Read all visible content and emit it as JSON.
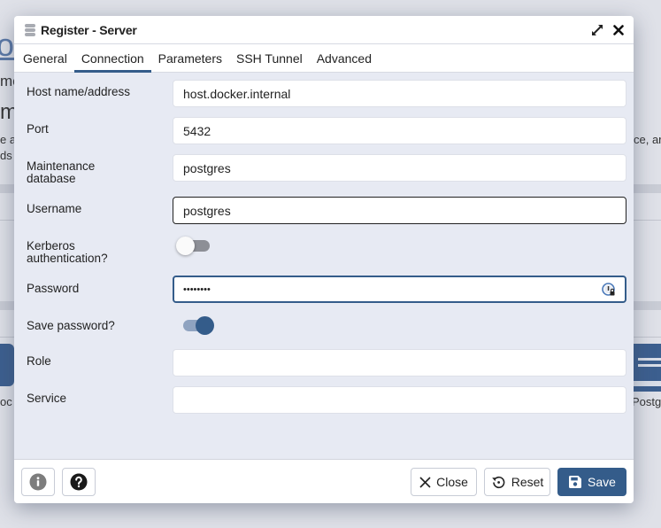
{
  "background": {
    "heading_fragment": "o",
    "line_fragments": [
      "me",
      "m",
      "e ac",
      "ds"
    ],
    "right_fragment": "ce, ar",
    "left_caption": "oc",
    "right_caption": "Postg"
  },
  "dialog": {
    "title": "Register - Server",
    "title_icon": "server-icon",
    "actions": {
      "maximize_icon": "expand-icon",
      "close_icon": "close-icon"
    },
    "tabs": [
      {
        "label": "General",
        "active": false
      },
      {
        "label": "Connection",
        "active": true
      },
      {
        "label": "Parameters",
        "active": false
      },
      {
        "label": "SSH Tunnel",
        "active": false
      },
      {
        "label": "Advanced",
        "active": false
      }
    ],
    "fields": {
      "host": {
        "label": "Host name/address",
        "value": "host.docker.internal"
      },
      "port": {
        "label": "Port",
        "value": "5432"
      },
      "maintenance_db": {
        "label_line1": "Maintenance",
        "label_line2": "database",
        "value": "postgres"
      },
      "username": {
        "label": "Username",
        "value": "postgres"
      },
      "kerberos": {
        "label_line1": "Kerberos",
        "label_line2": "authentication?",
        "enabled": false
      },
      "password": {
        "label": "Password",
        "value": "••••••••"
      },
      "save_password": {
        "label": "Save password?",
        "enabled": true
      },
      "role": {
        "label": "Role",
        "value": ""
      },
      "service": {
        "label": "Service",
        "value": ""
      }
    },
    "footer": {
      "info_icon": "info-icon",
      "help_icon": "help-icon",
      "close_label": "Close",
      "reset_label": "Reset",
      "save_label": "Save"
    },
    "colors": {
      "accent": "#345c8a",
      "dialog_bg": "#e7eaf3",
      "toggle_off_track": "#8d8f96",
      "toggle_on_track": "#8fa3c0"
    }
  }
}
